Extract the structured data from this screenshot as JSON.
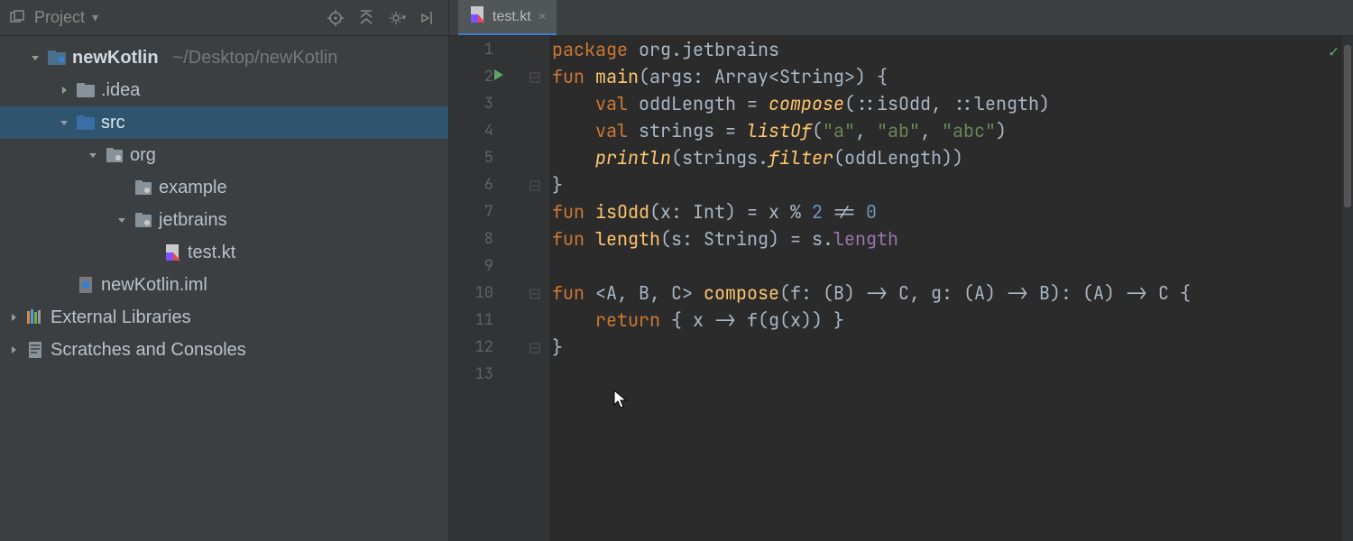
{
  "sidebar": {
    "title": "Project",
    "tree": [
      {
        "label": "newKotlin",
        "path": "~/Desktop/newKotlin",
        "bold": true,
        "indent": 0,
        "arrow": "down",
        "icon": "module",
        "selected": false
      },
      {
        "label": ".idea",
        "indent": 1,
        "arrow": "right",
        "icon": "folder",
        "selected": false
      },
      {
        "label": "src",
        "indent": 1,
        "arrow": "down",
        "icon": "src-folder",
        "selected": true
      },
      {
        "label": "org",
        "indent": 2,
        "arrow": "down",
        "icon": "package",
        "selected": false
      },
      {
        "label": "example",
        "indent": 3,
        "arrow": "none",
        "icon": "package",
        "selected": false
      },
      {
        "label": "jetbrains",
        "indent": 3,
        "arrow": "down",
        "icon": "package",
        "selected": false
      },
      {
        "label": "test.kt",
        "indent": 4,
        "arrow": "none",
        "icon": "kt-file",
        "selected": false
      },
      {
        "label": "newKotlin.iml",
        "indent": 1,
        "arrow": "none",
        "icon": "iml-file",
        "selected": false
      },
      {
        "label": "External Libraries",
        "indent": -1,
        "arrow": "right",
        "icon": "libs",
        "selected": false
      },
      {
        "label": "Scratches and Consoles",
        "indent": -1,
        "arrow": "right",
        "icon": "scratches",
        "selected": false
      }
    ]
  },
  "tabs": [
    {
      "label": "test.kt",
      "icon": "kt-file"
    }
  ],
  "gutter": {
    "lines": [
      "1",
      "2",
      "3",
      "4",
      "5",
      "6",
      "7",
      "8",
      "9",
      "10",
      "11",
      "12",
      "13"
    ],
    "runLine": 2,
    "foldLines": [
      2,
      6,
      10,
      12
    ]
  },
  "code": {
    "lines": [
      [
        [
          "kw",
          "package "
        ],
        [
          "d",
          "org.jetbrains"
        ]
      ],
      [
        [
          "kw",
          "fun "
        ],
        [
          "fn",
          "main"
        ],
        [
          "d",
          "(args: Array<String>) {"
        ]
      ],
      [
        [
          "d",
          "    "
        ],
        [
          "kw",
          "val "
        ],
        [
          "d",
          "oddLength = "
        ],
        [
          "fn-i",
          "compose"
        ],
        [
          "d",
          "("
        ],
        [
          "d",
          "::isOdd, ::length)"
        ]
      ],
      [
        [
          "d",
          "    "
        ],
        [
          "kw",
          "val "
        ],
        [
          "d",
          "strings = "
        ],
        [
          "fn-i",
          "listOf"
        ],
        [
          "d",
          "("
        ],
        [
          "str",
          "\"a\""
        ],
        [
          "d",
          ", "
        ],
        [
          "str",
          "\"ab\""
        ],
        [
          "d",
          ", "
        ],
        [
          "str",
          "\"abc\""
        ],
        [
          "d",
          ")"
        ]
      ],
      [
        [
          "d",
          "    "
        ],
        [
          "fn-i",
          "println"
        ],
        [
          "d",
          "(strings."
        ],
        [
          "fn-i",
          "filter"
        ],
        [
          "d",
          "(oddLength))"
        ]
      ],
      [
        [
          "d",
          "}"
        ]
      ],
      [
        [
          "kw",
          "fun "
        ],
        [
          "fn",
          "isOdd"
        ],
        [
          "d",
          "(x: Int) = x % "
        ],
        [
          "num",
          "2"
        ],
        [
          "d",
          " != "
        ],
        [
          "num",
          "0"
        ]
      ],
      [
        [
          "kw",
          "fun "
        ],
        [
          "fn",
          "length"
        ],
        [
          "d",
          "(s: String) = s."
        ],
        [
          "prop",
          "length"
        ]
      ],
      [],
      [
        [
          "kw",
          "fun "
        ],
        [
          "d",
          "<A, B, C> "
        ],
        [
          "fn",
          "compose"
        ],
        [
          "d",
          "(f: (B) -> C, g: (A) -> B): (A) -> C {"
        ]
      ],
      [
        [
          "d",
          "    "
        ],
        [
          "kw",
          "return "
        ],
        [
          "d",
          "{ x -> f(g(x)) }"
        ]
      ],
      [
        [
          "d",
          "}"
        ]
      ],
      []
    ]
  },
  "status_ok": "✓"
}
